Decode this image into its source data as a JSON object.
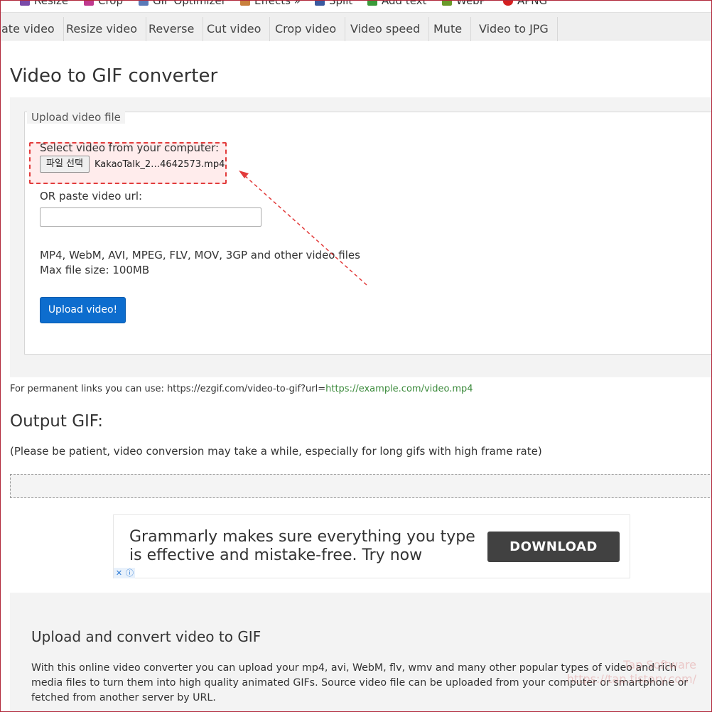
{
  "top_menu": {
    "items": [
      {
        "label": "Resize",
        "icon": "resize-icon",
        "color": "#7a4aa8"
      },
      {
        "label": "Crop",
        "icon": "crop-icon",
        "color": "#c0398e"
      },
      {
        "label": "GIF Optimizer",
        "icon": "optimizer-icon",
        "color": "#5a7ab8"
      },
      {
        "label": "Effects »",
        "icon": "effects-icon",
        "color": "#c9803c"
      },
      {
        "label": "Split",
        "icon": "split-icon",
        "color": "#3a5aa0"
      },
      {
        "label": "Add text",
        "icon": "add-text-icon",
        "color": "#3a9a3a"
      },
      {
        "label": "WebP",
        "icon": "webp-icon",
        "color": "#6a9a2a"
      },
      {
        "label": "APNG",
        "icon": "apng-icon",
        "color": "#d42020"
      }
    ]
  },
  "tabs": [
    "ate video",
    "Resize video",
    "Reverse",
    "Cut video",
    "Crop video",
    "Video speed",
    "Mute",
    "Video to JPG"
  ],
  "page_title": "Video to GIF converter",
  "upload": {
    "legend": "Upload video file",
    "select_label": "Select video from your computer:",
    "file_button": "파일 선택",
    "file_name": "KakaoTalk_2…4642573.mp4",
    "url_label": "OR paste video url:",
    "url_value": "",
    "formats": "MP4, WebM, AVI, MPEG, FLV, MOV, 3GP and other video files",
    "max_size": "Max file size: 100MB",
    "submit": "Upload video!"
  },
  "permalink": {
    "text": "For permanent links you can use: https://ezgif.com/video-to-gif?url=",
    "example": "https://example.com/video.mp4"
  },
  "output": {
    "heading": "Output GIF:",
    "note": "(Please be patient, video conversion may take a while, especially for long gifs with high frame rate)"
  },
  "ad": {
    "text": "Grammarly makes sure everything you type is effective and mistake-free. Try now",
    "button": "DOWNLOAD",
    "close_glyph": "✕",
    "info_glyph": "ⓘ"
  },
  "info": {
    "heading": "Upload and convert video to GIF",
    "paragraph": "With this online video converter you can upload your mp4, avi, WebM, flv, wmv and many other popular types of video and rich media files to turn them into high quality animated GIFs. Source video file can be uploaded from your computer or smartphone or fetched from another server by URL."
  },
  "watermark": {
    "line1": "Tap Software",
    "line2": "https://tap.tistory.com/"
  },
  "colors": {
    "tab_bg": "#efefef",
    "primary_button": "#0d6dce",
    "highlight": "#e23b3b",
    "link_green": "#3b8a3b",
    "ad_button": "#414141"
  }
}
